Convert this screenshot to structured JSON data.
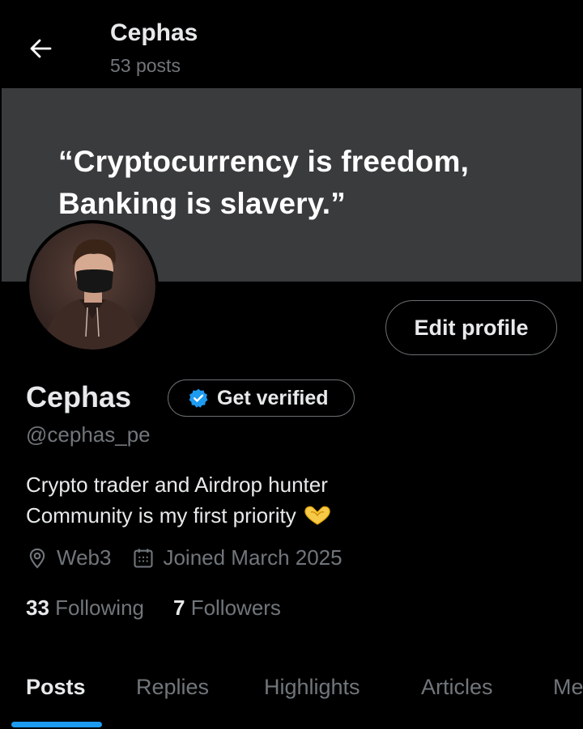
{
  "header": {
    "title": "Cephas",
    "post_count": "53 posts",
    "back_icon": "arrow-left-icon"
  },
  "banner": {
    "quote_line1": "“Cryptocurrency is freedom,",
    "quote_line2": "Banking is slavery.”",
    "background": "#3a3b3d"
  },
  "profile": {
    "edit_label": "Edit profile",
    "name": "Cephas",
    "get_verified_label": "Get verified",
    "handle": "@cephas_pe",
    "bio_line1": "Crypto trader and Airdrop hunter",
    "bio_line2": "Community is my first priority",
    "location": "Web3",
    "joined": "Joined March 2025",
    "following_count": "33",
    "following_label": "Following",
    "followers_count": "7",
    "followers_label": "Followers"
  },
  "tabs": [
    {
      "label": "Posts",
      "active": true
    },
    {
      "label": "Replies"
    },
    {
      "label": "Highlights"
    },
    {
      "label": "Articles"
    },
    {
      "label": "Me"
    }
  ],
  "colors": {
    "accent": "#1d9bf0",
    "text_primary": "#e7e9ea",
    "text_secondary": "#71767b",
    "background": "#000000"
  }
}
